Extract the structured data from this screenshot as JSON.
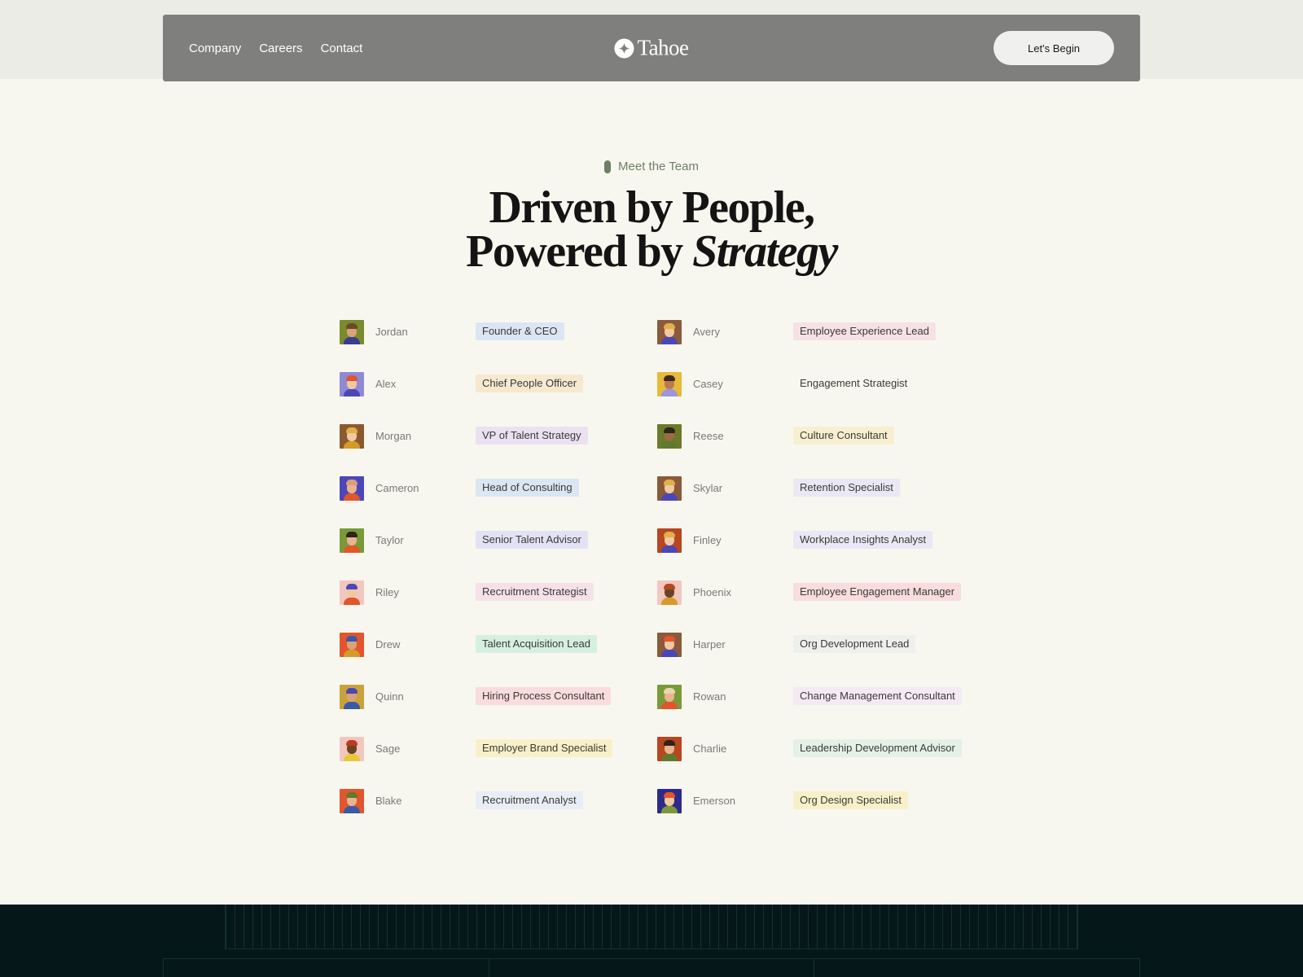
{
  "nav": {
    "links": [
      "Company",
      "Careers",
      "Contact"
    ],
    "brand": "Tahoe",
    "cta": "Let's Begin"
  },
  "hero": {
    "eyebrow": "Meet the Team",
    "headline_line1": "Driven by People,",
    "headline_line2_prefix": "Powered by ",
    "headline_line2_emphasis": "Strategy"
  },
  "team": [
    {
      "name": "Jordan",
      "role": "Founder & CEO",
      "tag_color": "#dbe6f3",
      "avatar_bg": "#7a8a2e",
      "hair": "#6b4a2a",
      "skin": "#d9a277",
      "shirt": "#3a3d8f"
    },
    {
      "name": "Avery",
      "role": "Employee Experience Lead",
      "tag_color": "#f6e1e6",
      "avatar_bg": "#8a5a3a",
      "hair": "#e0b04a",
      "skin": "#f0c9a0",
      "shirt": "#4b47b8"
    },
    {
      "name": "Alex",
      "role": "Chief People Officer",
      "tag_color": "#f7e9cf",
      "avatar_bg": "#8f8ad6",
      "hair": "#e2552d",
      "skin": "#f2c7a5",
      "shirt": "#4b47b8"
    },
    {
      "name": "Casey",
      "role": "Engagement Strategist",
      "tag_color": "#f8f7ef",
      "avatar_bg": "#e8b93a",
      "hair": "#3a2a1e",
      "skin": "#b97a4e",
      "shirt": "#9c96e0"
    },
    {
      "name": "Morgan",
      "role": "VP of Talent Strategy",
      "tag_color": "#ebe1f1",
      "avatar_bg": "#8a5a2e",
      "hair": "#e0b04a",
      "skin": "#f0c9a0",
      "shirt": "#d59a2a"
    },
    {
      "name": "Reese",
      "role": "Culture Consultant",
      "tag_color": "#f7efcf",
      "avatar_bg": "#6b7a2a",
      "hair": "#2e2418",
      "skin": "#9a6a42",
      "shirt": "#5f7a2e"
    },
    {
      "name": "Cameron",
      "role": "Head of Consulting",
      "tag_color": "#dbe6f3",
      "avatar_bg": "#4b47b8",
      "hair": "#d8a07a",
      "skin": "#e9b48f",
      "shirt": "#e2552d"
    },
    {
      "name": "Skylar",
      "role": "Retention Specialist",
      "tag_color": "#e9e8f4",
      "avatar_bg": "#8a5a3a",
      "hair": "#e0b04a",
      "skin": "#f0c9a0",
      "shirt": "#4b47b8"
    },
    {
      "name": "Taylor",
      "role": "Senior Talent Advisor",
      "tag_color": "#e3e2f5",
      "avatar_bg": "#7a9a3a",
      "hair": "#2e2418",
      "skin": "#e9b48f",
      "shirt": "#e2552d"
    },
    {
      "name": "Finley",
      "role": "Workplace Insights Analyst",
      "tag_color": "#e9e8f4",
      "avatar_bg": "#b8461f",
      "hair": "#e0b04a",
      "skin": "#f2c7a5",
      "shirt": "#4b47b8"
    },
    {
      "name": "Riley",
      "role": "Recruitment Strategist",
      "tag_color": "#f6e1e9",
      "avatar_bg": "#f2c7c0",
      "hair": "#4b47b8",
      "skin": "#f0c9a0",
      "shirt": "#e2552d"
    },
    {
      "name": "Phoenix",
      "role": "Employee Engagement Manager",
      "tag_color": "#f9dcdc",
      "avatar_bg": "#f2c7c0",
      "hair": "#b8461f",
      "skin": "#6a4428",
      "shirt": "#d59a2a"
    },
    {
      "name": "Drew",
      "role": "Talent Acquisition Lead",
      "tag_color": "#d6f0df",
      "avatar_bg": "#e2552d",
      "hair": "#3a5aa8",
      "skin": "#d9a277",
      "shirt": "#d59a2a"
    },
    {
      "name": "Harper",
      "role": "Org Development Lead",
      "tag_color": "#eef0ee",
      "avatar_bg": "#8a5a3a",
      "hair": "#e2552d",
      "skin": "#f2c7a5",
      "shirt": "#4b47b8"
    },
    {
      "name": "Quinn",
      "role": "Hiring Process Consultant",
      "tag_color": "#f9dcdc",
      "avatar_bg": "#c9a23a",
      "hair": "#4b47b8",
      "skin": "#d9a277",
      "shirt": "#3a5aa8"
    },
    {
      "name": "Rowan",
      "role": "Change Management Consultant",
      "tag_color": "#f3eaf3",
      "avatar_bg": "#7a9a3a",
      "hair": "#e9d5b0",
      "skin": "#e9b48f",
      "shirt": "#e2552d"
    },
    {
      "name": "Sage",
      "role": "Employer Brand Specialist",
      "tag_color": "#f8f0c8",
      "avatar_bg": "#f2c7c0",
      "hair": "#c23a1e",
      "skin": "#6a4428",
      "shirt": "#e8c83a"
    },
    {
      "name": "Charlie",
      "role": "Leadership Development Advisor",
      "tag_color": "#e3f1e6",
      "avatar_bg": "#b8461f",
      "hair": "#2e2418",
      "skin": "#e9b48f",
      "shirt": "#5f7a2e"
    },
    {
      "name": "Blake",
      "role": "Recruitment Analyst",
      "tag_color": "#e9eef6",
      "avatar_bg": "#e2552d",
      "hair": "#5f7a2e",
      "skin": "#e9b48f",
      "shirt": "#3a5aa8"
    },
    {
      "name": "Emerson",
      "role": "Org Design Specialist",
      "tag_color": "#f8f0c8",
      "avatar_bg": "#2e2a8a",
      "hair": "#e2552d",
      "skin": "#f2c7a5",
      "shirt": "#7a9a3a"
    }
  ],
  "colors": {
    "page_bg": "#f8f7ef",
    "nav_bg": "#7f7f7e",
    "accent_green": "#6e7f65",
    "footer_bg": "#061719"
  }
}
